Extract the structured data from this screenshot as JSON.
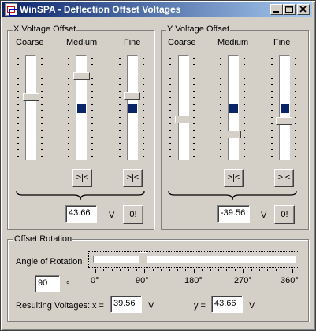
{
  "window": {
    "title": "WinSPA - Deflection Offset Voltages"
  },
  "x_offset": {
    "title": "X Voltage Offset",
    "labels": [
      "Coarse",
      "Medium",
      "Fine"
    ],
    "reset_label": ">|<",
    "value": "43.66",
    "unit": "V",
    "zero_label": "0!"
  },
  "y_offset": {
    "title": "Y Voltage Offset",
    "labels": [
      "Coarse",
      "Medium",
      "Fine"
    ],
    "reset_label": ">|<",
    "value": "-39.56",
    "unit": "V",
    "zero_label": "0!"
  },
  "rotation": {
    "title": "Offset Rotation",
    "angle_label": "Angle of Rotation",
    "angle_value": "90",
    "degree_sign": "°",
    "ticks": [
      "0°",
      "90°",
      "180°",
      "270°",
      "360°"
    ],
    "result_label": "Resulting Voltages:",
    "x_label": "x =",
    "x_value": "39.56",
    "y_label": "y =",
    "y_value": "43.66",
    "unit": "V"
  }
}
